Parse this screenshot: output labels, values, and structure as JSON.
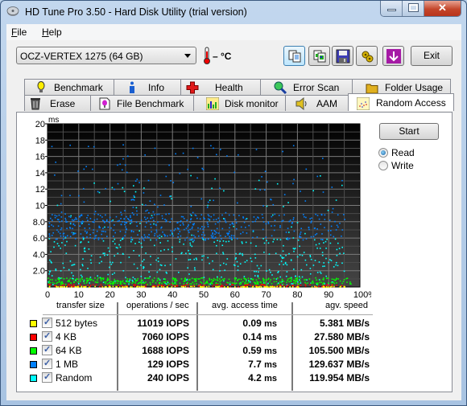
{
  "window": {
    "title": "HD Tune Pro 3.50 - Hard Disk Utility (trial version)",
    "caption_buttons": [
      "minimize",
      "maximize",
      "close"
    ]
  },
  "menu": [
    {
      "label": "File",
      "accel": "F",
      "rest": "ile"
    },
    {
      "label": "Help",
      "accel": "H",
      "rest": "elp"
    }
  ],
  "toolbar": {
    "drive": "OCZ-VERTEX 1275 (64 GB)",
    "temperature": "– °C",
    "buttons": [
      {
        "name": "copy-text-icon",
        "state": "active"
      },
      {
        "name": "copy-screenshot-icon"
      },
      {
        "name": "save-icon"
      },
      {
        "name": "options-icon"
      },
      {
        "name": "download-icon"
      }
    ],
    "exit_label": "Exit"
  },
  "tabs_row1": [
    {
      "label": "Benchmark",
      "icon": "bulb-icon"
    },
    {
      "label": "Info",
      "icon": "info-icon"
    },
    {
      "label": "Health",
      "icon": "health-cross-icon"
    },
    {
      "label": "Error Scan",
      "icon": "magnifier-icon"
    },
    {
      "label": "Folder Usage",
      "icon": "folder-icon"
    }
  ],
  "tabs_row2": [
    {
      "label": "Erase",
      "icon": "trash-icon"
    },
    {
      "label": "File Benchmark",
      "icon": "file-bulb-icon"
    },
    {
      "label": "Disk monitor",
      "icon": "disk-monitor-icon"
    },
    {
      "label": "AAM",
      "icon": "speaker-icon"
    },
    {
      "label": "Random Access",
      "icon": "scatter-icon",
      "selected": true
    }
  ],
  "controls": {
    "start_label": "Start",
    "mode_options": [
      {
        "label": "Read",
        "checked": true
      },
      {
        "label": "Write",
        "checked": false
      }
    ]
  },
  "results": {
    "headers": [
      "transfer size",
      "operations / sec",
      "avg. access time",
      "agv. speed"
    ],
    "rows": [
      {
        "size": "512 bytes",
        "color": "#ffff00",
        "checked": true,
        "iops": "11019",
        "iops_unit": "IOPS",
        "access": "0.09",
        "access_unit": "ms",
        "speed": "5.381",
        "speed_unit": "MB/s"
      },
      {
        "size": "4 KB",
        "color": "#ff0000",
        "checked": true,
        "iops": "7060",
        "iops_unit": "IOPS",
        "access": "0.14",
        "access_unit": "ms",
        "speed": "27.580",
        "speed_unit": "MB/s"
      },
      {
        "size": "64 KB",
        "color": "#00ff00",
        "checked": true,
        "iops": "1688",
        "iops_unit": "IOPS",
        "access": "0.59",
        "access_unit": "ms",
        "speed": "105.500",
        "speed_unit": "MB/s"
      },
      {
        "size": "1 MB",
        "color": "#0080ff",
        "checked": true,
        "iops": "129",
        "iops_unit": "IOPS",
        "access": "7.7",
        "access_unit": "ms",
        "speed": "129.637",
        "speed_unit": "MB/s"
      },
      {
        "size": "Random",
        "color": "#00ffff",
        "checked": true,
        "iops": "240",
        "iops_unit": "IOPS",
        "access": "4.2",
        "access_unit": "ms",
        "speed": "119.954",
        "speed_unit": "MB/s"
      }
    ]
  },
  "chart_data": {
    "type": "scatter",
    "title": "",
    "ylabel": "ms",
    "xlabel": "",
    "ylim": [
      0,
      20
    ],
    "xlim": [
      0,
      100
    ],
    "y_ticks": [
      "2.0",
      "4.0",
      "6.0",
      "8.0",
      "10",
      "12",
      "14",
      "16",
      "18",
      "20"
    ],
    "x_ticks": [
      "0",
      "10",
      "20",
      "30",
      "40",
      "50",
      "60",
      "70",
      "80",
      "90",
      "100%"
    ],
    "grid": true,
    "background": "dark gradient",
    "series": [
      {
        "name": "512 bytes",
        "color": "#ffff00",
        "typical_ms": 0.09,
        "spread_ms": [
          0.05,
          0.15
        ],
        "x_extent": [
          0,
          95
        ],
        "approx_points": 150
      },
      {
        "name": "4 KB",
        "color": "#ff0000",
        "typical_ms": 0.14,
        "spread_ms": [
          0.1,
          0.4
        ],
        "x_extent": [
          0,
          95
        ],
        "approx_points": 150
      },
      {
        "name": "64 KB",
        "color": "#00ff00",
        "typical_ms": 0.59,
        "spread_ms": [
          0.4,
          1.2
        ],
        "x_extent": [
          0,
          97
        ],
        "approx_points": 400
      },
      {
        "name": "1 MB",
        "color": "#0080ff",
        "typical_ms": 7.7,
        "spread_ms": [
          5.5,
          17.5
        ],
        "x_extent": [
          0,
          95
        ],
        "approx_points": 700
      },
      {
        "name": "Random",
        "color": "#00ffff",
        "typical_ms": 4.2,
        "spread_ms": [
          0.2,
          14
        ],
        "x_extent": [
          0,
          95
        ],
        "approx_points": 450
      }
    ]
  }
}
